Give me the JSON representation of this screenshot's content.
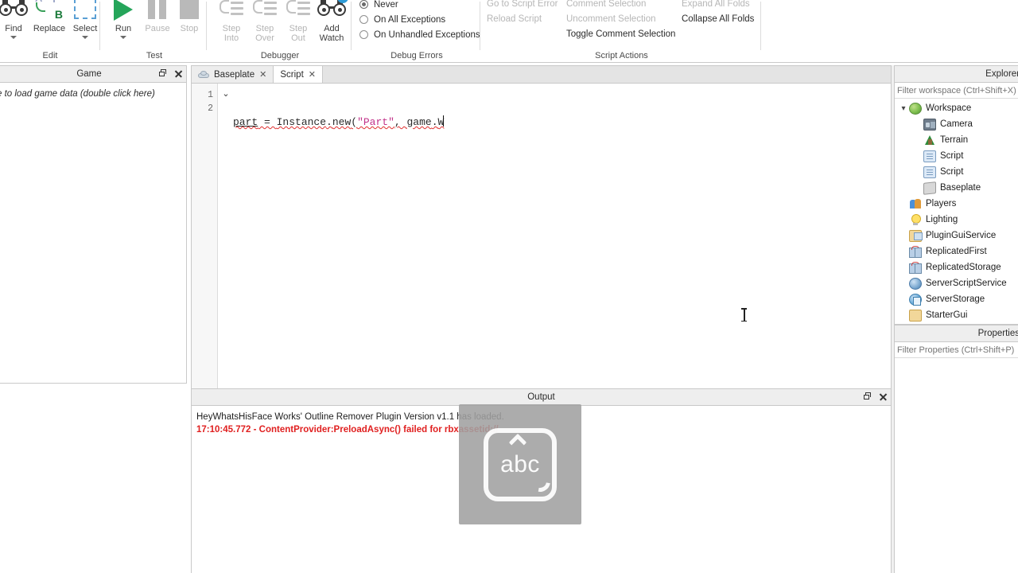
{
  "ribbon": {
    "groups": [
      {
        "label": "Edit",
        "buttons": [
          {
            "label": "Find",
            "icon": "binoculars-icon",
            "enabled": true,
            "dropdown": true
          },
          {
            "label": "Replace",
            "icon": "replace-ab-icon",
            "enabled": true,
            "dropdown": false
          },
          {
            "label": "Select",
            "icon": "select-box-icon",
            "enabled": true,
            "dropdown": true
          }
        ]
      },
      {
        "label": "Test",
        "buttons": [
          {
            "label": "Run",
            "icon": "play-icon",
            "enabled": true,
            "dropdown": true
          },
          {
            "label": "Pause",
            "icon": "pause-icon",
            "enabled": false,
            "dropdown": false
          },
          {
            "label": "Stop",
            "icon": "stop-icon",
            "enabled": false,
            "dropdown": false
          }
        ]
      },
      {
        "label": "Debugger",
        "buttons": [
          {
            "label_line1": "Step",
            "label_line2": "Into",
            "icon": "step-into-icon",
            "enabled": false
          },
          {
            "label_line1": "Step",
            "label_line2": "Over",
            "icon": "step-over-icon",
            "enabled": false
          },
          {
            "label_line1": "Step",
            "label_line2": "Out",
            "icon": "step-out-icon",
            "enabled": false
          },
          {
            "label_line1": "Add",
            "label_line2": "Watch",
            "icon": "add-watch-icon",
            "enabled": true
          }
        ]
      },
      {
        "label": "Debug Errors",
        "radios": [
          {
            "label": "Never",
            "selected": true
          },
          {
            "label": "On All Exceptions",
            "selected": false
          },
          {
            "label": "On Unhandled Exceptions",
            "selected": false
          }
        ]
      },
      {
        "label": "Script Actions",
        "column_a": [
          {
            "label": "Go to Script Error",
            "enabled": false
          },
          {
            "label": "Reload Script",
            "enabled": false
          }
        ],
        "column_b": [
          {
            "label": "Comment Selection",
            "enabled": false
          },
          {
            "label": "Uncomment Selection",
            "enabled": false
          },
          {
            "label": "Toggle Comment Selection",
            "enabled": true
          }
        ],
        "column_c": [
          {
            "label": "Expand All Folds",
            "enabled": false
          },
          {
            "label": "Collapse All Folds",
            "enabled": true
          }
        ]
      }
    ]
  },
  "game_panel": {
    "title": "Game",
    "message": "e to load game data (double click here)"
  },
  "editor": {
    "tabs": [
      {
        "label": "Baseplate",
        "icon": "cloud-icon",
        "active": false,
        "closable": true
      },
      {
        "label": "Script",
        "icon": "none",
        "active": true,
        "closable": true
      }
    ],
    "line_numbers": [
      "1",
      "2"
    ],
    "fold_arrow": "⌄",
    "code": {
      "line1_tokens": [
        {
          "text": "part",
          "type": "ident-underlined"
        },
        {
          "text": " = ",
          "type": "punct"
        },
        {
          "text": "Instance",
          "type": "ident"
        },
        {
          "text": ".",
          "type": "punct"
        },
        {
          "text": "new",
          "type": "ident"
        },
        {
          "text": "(",
          "type": "punct"
        },
        {
          "text": "\"Part\"",
          "type": "string"
        },
        {
          "text": ", ",
          "type": "punct"
        },
        {
          "text": "game",
          "type": "ident"
        },
        {
          "text": ".",
          "type": "punct"
        },
        {
          "text": "W",
          "type": "ident"
        }
      ],
      "line1_plain": "part = Instance.new(\"Part\", game.W",
      "line2_plain": ""
    }
  },
  "output": {
    "title": "Output",
    "lines": [
      {
        "text": "HeyWhatsHisFace Works' Outline Remover Plugin Version v1.1 has loaded.",
        "level": "info"
      },
      {
        "text": "17:10:45.772 - ContentProvider:PreloadAsync() failed for rbxassetid://",
        "level": "error"
      }
    ]
  },
  "explorer": {
    "title": "Explorer",
    "filter_placeholder": "Filter workspace (Ctrl+Shift+X)",
    "filter_value": "",
    "tree": [
      {
        "label": "Workspace",
        "icon": "globe-icon",
        "depth": 0,
        "expanded": true
      },
      {
        "label": "Camera",
        "icon": "camera-icon",
        "depth": 1
      },
      {
        "label": "Terrain",
        "icon": "terrain-icon",
        "depth": 1
      },
      {
        "label": "Script",
        "icon": "script-icon",
        "depth": 1
      },
      {
        "label": "Script",
        "icon": "script-icon",
        "depth": 1
      },
      {
        "label": "Baseplate",
        "icon": "part-icon",
        "depth": 1
      },
      {
        "label": "Players",
        "icon": "players-icon",
        "depth": 0
      },
      {
        "label": "Lighting",
        "icon": "lightbulb-icon",
        "depth": 0
      },
      {
        "label": "PluginGuiService",
        "icon": "plugin-gui-icon",
        "depth": 0
      },
      {
        "label": "ReplicatedFirst",
        "icon": "replicated-icon",
        "depth": 0
      },
      {
        "label": "ReplicatedStorage",
        "icon": "replicated-icon",
        "depth": 0
      },
      {
        "label": "ServerScriptService",
        "icon": "server-script-service-icon",
        "depth": 0
      },
      {
        "label": "ServerStorage",
        "icon": "server-storage-icon",
        "depth": 0
      },
      {
        "label": "StarterGui",
        "icon": "starter-gui-icon",
        "depth": 0
      }
    ]
  },
  "properties": {
    "title": "Properties",
    "filter_placeholder": "Filter Properties (Ctrl+Shift+P)",
    "filter_value": ""
  },
  "ime_overlay": {
    "key_label": "abc"
  },
  "colors": {
    "accent_green": "#25a55a",
    "error_red": "#e02020",
    "string_pink": "#c2338a",
    "panel_bg": "#eeeeee",
    "border": "#c9c9c9"
  }
}
